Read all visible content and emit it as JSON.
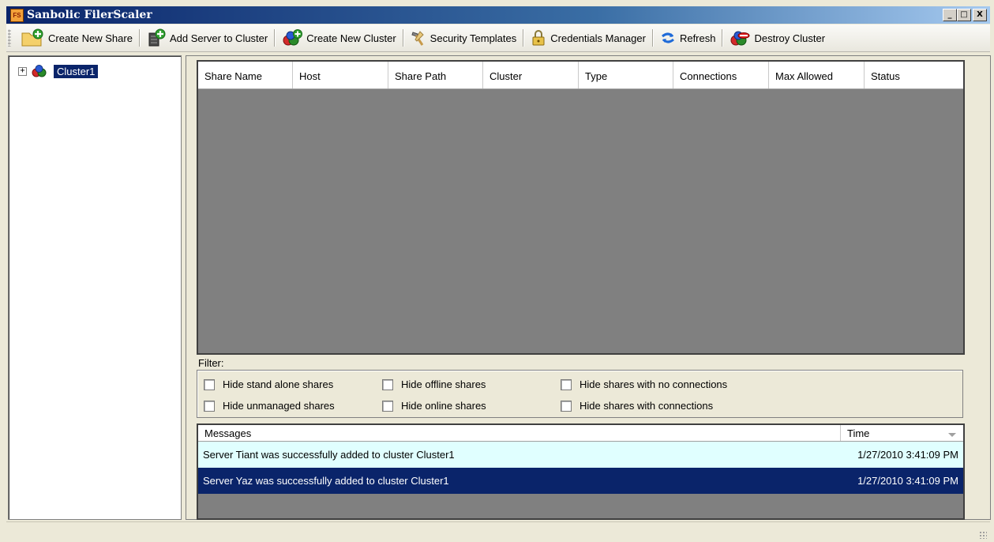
{
  "window": {
    "title": "Sanbolic FilerScaler",
    "logo_text": "FS",
    "minimize": "_",
    "maximize": "□",
    "close": "X"
  },
  "toolbar": {
    "create_share": "Create New Share",
    "add_server": "Add Server to Cluster",
    "create_cluster": "Create New Cluster",
    "security_templates": "Security Templates",
    "credentials_manager": "Credentials Manager",
    "refresh": "Refresh",
    "destroy_cluster": "Destroy Cluster"
  },
  "tree": {
    "expander": "+",
    "cluster_label": "Cluster1"
  },
  "shares_grid": {
    "columns": [
      "Share Name",
      "Host",
      "Share Path",
      "Cluster",
      "Type",
      "Connections",
      "Max Allowed",
      "Status"
    ]
  },
  "filter": {
    "title": "Filter:",
    "options": [
      "Hide stand alone shares",
      "Hide offline shares",
      "Hide shares with no connections",
      "Hide unmanaged shares",
      "Hide online shares",
      "Hide shares with connections"
    ]
  },
  "messages": {
    "header_message": "Messages",
    "header_time": "Time",
    "rows": [
      {
        "text": "Server Tiant was successfully added to cluster Cluster1",
        "time": "1/27/2010 3:41:09 PM"
      },
      {
        "text": "Server Yaz was successfully added to cluster Cluster1",
        "time": "1/27/2010 3:41:09 PM"
      }
    ]
  },
  "colors": {
    "title_gradient_start": "#0a246a",
    "selection": "#0a246a",
    "message_row_light": "#e0ffff",
    "grid_background": "#808080"
  }
}
